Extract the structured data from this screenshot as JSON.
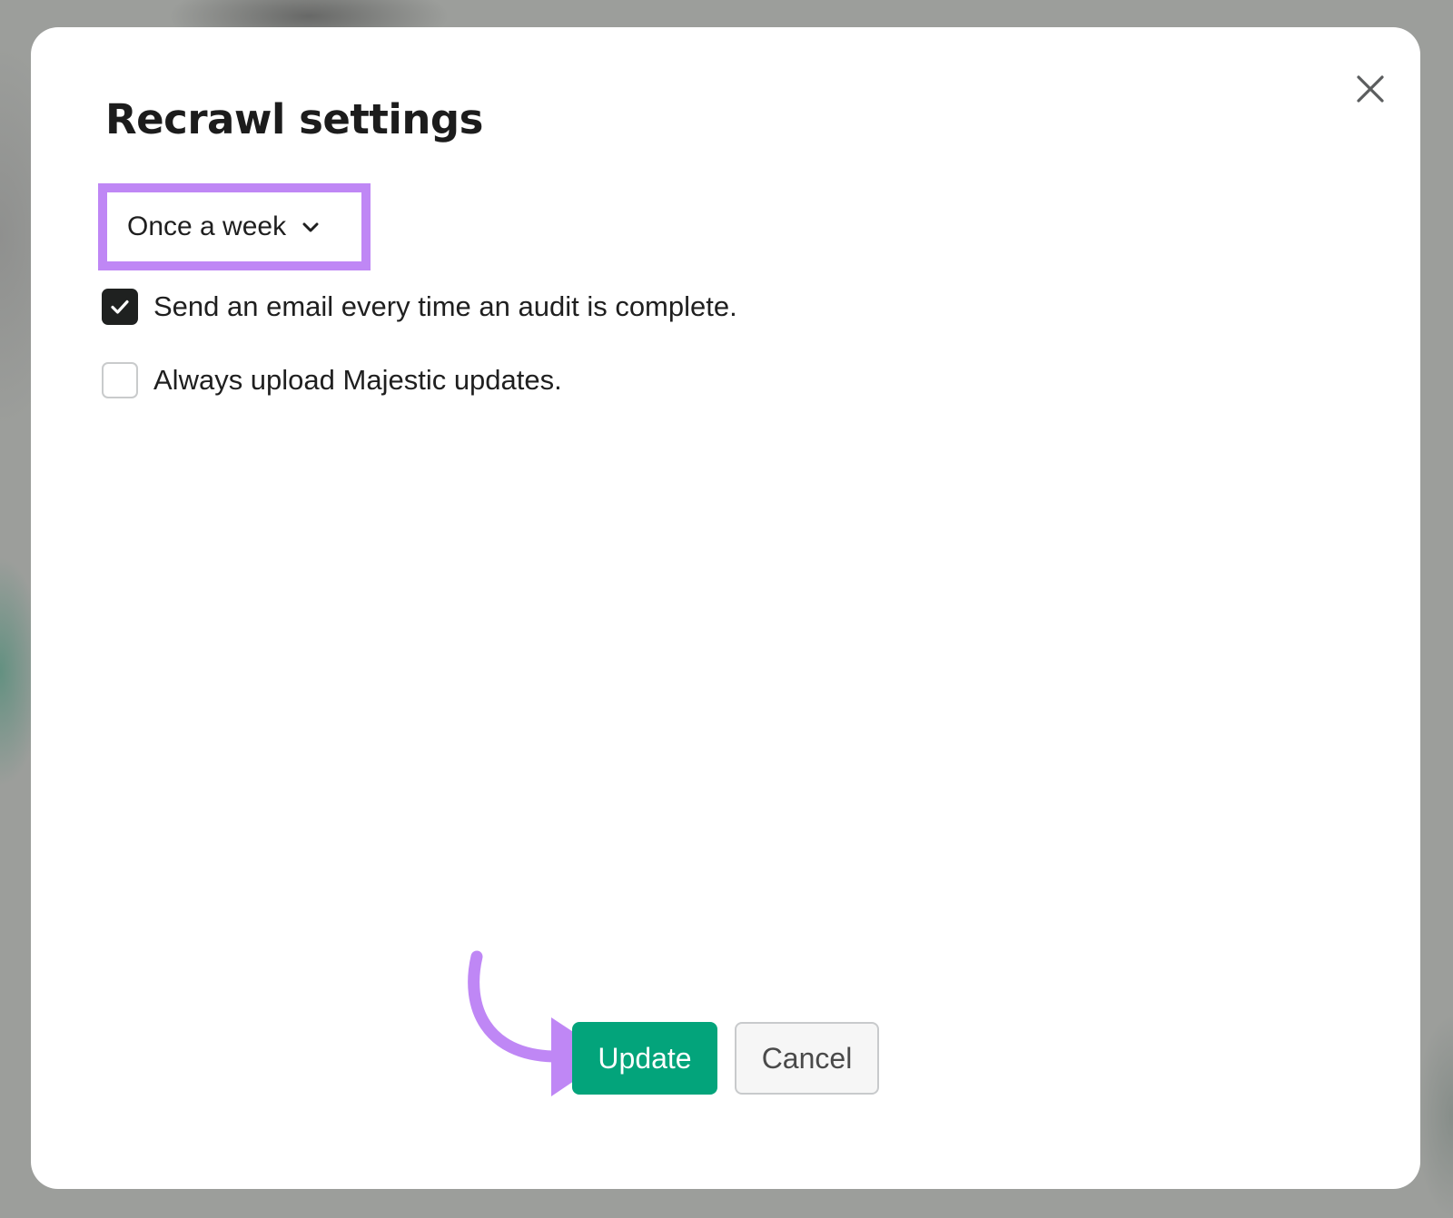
{
  "dialog": {
    "title": "Recrawl settings",
    "frequency": {
      "selected": "Once a week"
    },
    "options": [
      {
        "label": "Send an email every time an audit is complete.",
        "checked": true
      },
      {
        "label": "Always upload Majestic updates.",
        "checked": false
      }
    ],
    "buttons": {
      "update_label": "Update",
      "cancel_label": "Cancel"
    }
  },
  "icons": {
    "close": "close-icon",
    "dropdown": "chevron-down-icon",
    "check": "checkmark-icon",
    "annotation": "curved-arrow-icon"
  },
  "colors": {
    "primary_button": "#03a47b",
    "highlight": "#bf87f5",
    "checkbox_checked": "#1f2120"
  }
}
